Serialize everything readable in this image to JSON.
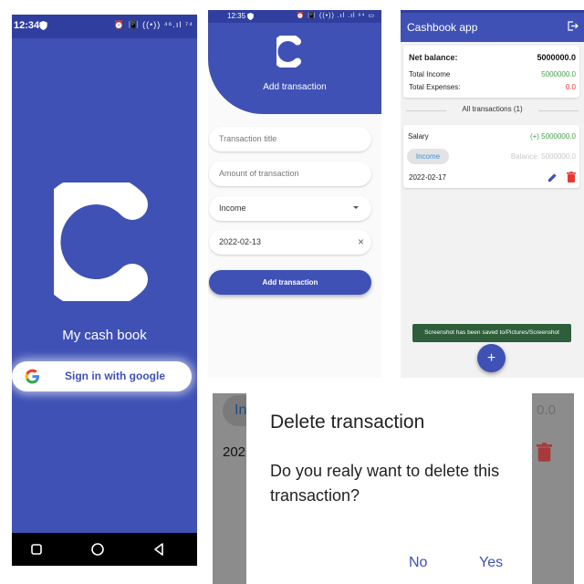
{
  "splash": {
    "status_time": "12:34",
    "status_right": "⏰ 📳 ((•)) ⁴⁶.ıl ⁷⁴",
    "app_name": "My cash book",
    "sign_in_label": "Sign in with google"
  },
  "add_screen": {
    "status_time": "12:35",
    "status_right": "⏰ 📳 ((•)) .ıl .ıl ⁶⁴ ▭",
    "title": "Add transaction",
    "title_placeholder": "Transaction title",
    "amount_placeholder": "Amount of transaction",
    "type_value": "Income",
    "date_value": "2022-02-13",
    "clear_glyph": "×",
    "submit_label": "Add transaction"
  },
  "list_screen": {
    "app_title": "Cashbook app",
    "net_balance_label": "Net balance:",
    "net_balance_value": "5000000.0",
    "total_income_label": "Total Income",
    "total_income_value": "5000000.0",
    "total_expenses_label": "Total Expenses:",
    "total_expenses_value": "0.0",
    "section_label": "All transactions (1)",
    "transaction": {
      "title": "Salary",
      "amount": "(+) 5000000.0",
      "type_chip": "Income",
      "balance": "Balance: 5000000.0",
      "date": "2022-02-17"
    },
    "toast": "Screenshot has been saved to/Pictures/Screenshot",
    "fab_glyph": "+",
    "colors": {
      "income": "#43a047",
      "expense": "#e53935",
      "accent": "#3f51b5"
    }
  },
  "delete_dialog": {
    "bg_chip_fragment": "In",
    "bg_value_fragment": "0.0",
    "bg_date_fragment": "202",
    "title": "Delete transaction",
    "message": "Do you realy want to delete this transaction?",
    "no_label": "No",
    "yes_label": "Yes"
  },
  "icons": [
    "shield-icon",
    "app-logo-icon",
    "google-g-icon",
    "dropdown-arrow-icon",
    "clear-icon",
    "logout-icon",
    "edit-pencil-icon",
    "delete-trash-icon",
    "plus-icon",
    "nav-square-icon",
    "nav-circle-icon",
    "nav-back-icon"
  ]
}
